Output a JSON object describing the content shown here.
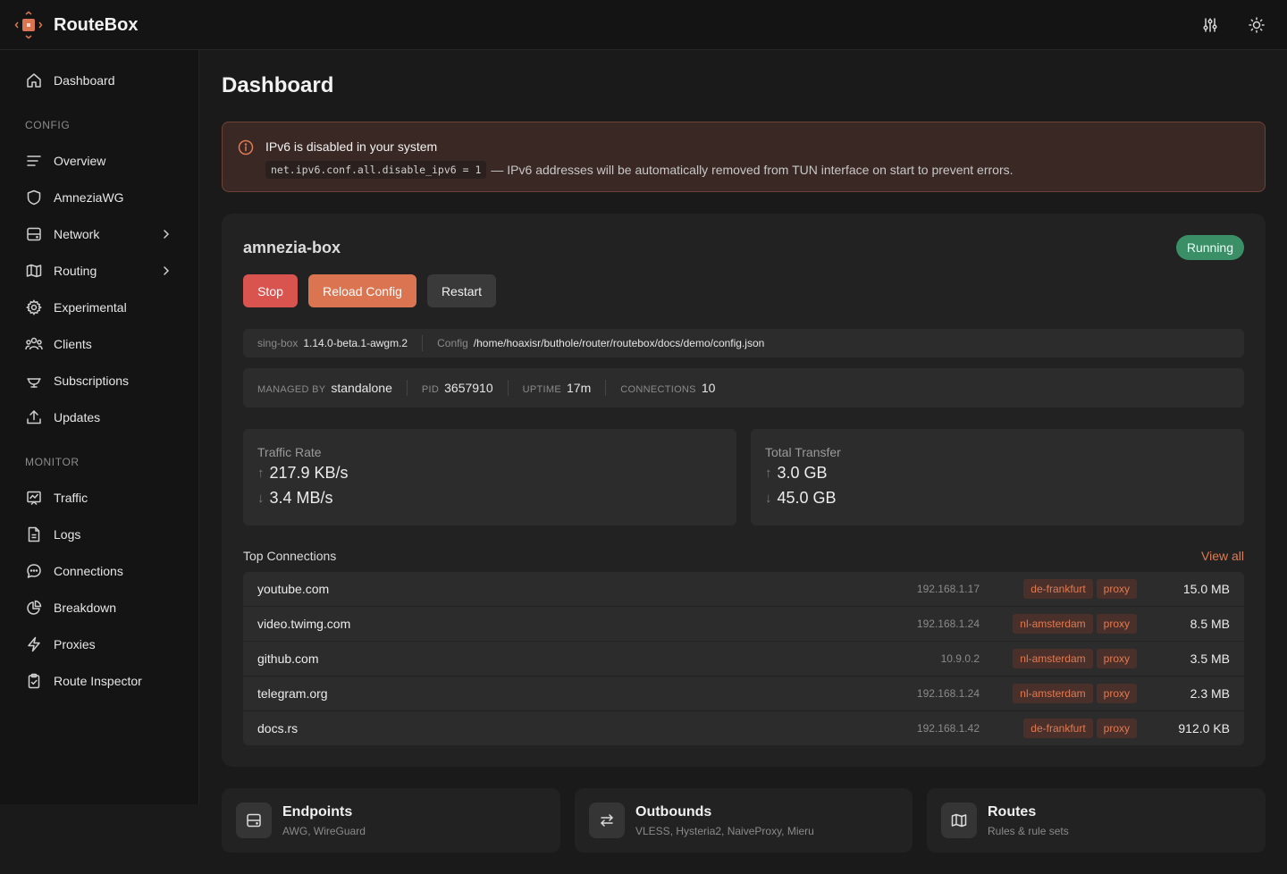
{
  "app": {
    "name": "RouteBox",
    "accent": "#db7450"
  },
  "header": {
    "icons": [
      "sliders-icon",
      "sun-icon"
    ]
  },
  "sidebar": {
    "sections": {
      "config": "CONFIG",
      "monitor": "MONITOR"
    },
    "items": [
      {
        "label": "Dashboard",
        "icon": "home-icon"
      },
      {
        "label": "Overview",
        "icon": "list-icon"
      },
      {
        "label": "AmneziaWG",
        "icon": "shield-icon"
      },
      {
        "label": "Network",
        "icon": "server-icon"
      },
      {
        "label": "Routing",
        "icon": "map-icon"
      },
      {
        "label": "Experimental",
        "icon": "gear-icon"
      },
      {
        "label": "Clients",
        "icon": "users-icon"
      },
      {
        "label": "Subscriptions",
        "icon": "bowl-icon"
      },
      {
        "label": "Updates",
        "icon": "upload-icon"
      },
      {
        "label": "Traffic",
        "icon": "chart-icon"
      },
      {
        "label": "Logs",
        "icon": "file-icon"
      },
      {
        "label": "Connections",
        "icon": "chat-icon"
      },
      {
        "label": "Breakdown",
        "icon": "pie-icon"
      },
      {
        "label": "Proxies",
        "icon": "bolt-icon"
      },
      {
        "label": "Route Inspector",
        "icon": "clipboard-check-icon"
      }
    ]
  },
  "page": {
    "title": "Dashboard"
  },
  "alert": {
    "title": "IPv6 is disabled in your system",
    "code": "net.ipv6.conf.all.disable_ipv6 = 1",
    "message": "— IPv6 addresses will be automatically removed from TUN interface on start to prevent errors."
  },
  "service": {
    "name": "amnezia-box",
    "status": "Running",
    "status_color": "#3b8f67",
    "buttons": {
      "stop": "Stop",
      "reload": "Reload Config",
      "restart": "Restart"
    },
    "info": {
      "singbox_label": "sing-box",
      "singbox_version": "1.14.0-beta.1-awgm.2",
      "config_label": "Config",
      "config_path": "/home/hoaxisr/buthole/router/routebox/docs/demo/config.json",
      "managed_label": "MANAGED BY",
      "managed_value": "standalone",
      "pid_label": "PID",
      "pid_value": "3657910",
      "uptime_label": "UPTIME",
      "uptime_value": "17m",
      "connections_label": "CONNECTIONS",
      "connections_value": "10"
    },
    "traffic_rate": {
      "title": "Traffic Rate",
      "up": "217.9 KB/s",
      "down": "3.4 MB/s"
    },
    "total_transfer": {
      "title": "Total Transfer",
      "up": "3.0 GB",
      "down": "45.0 GB"
    },
    "arrows": {
      "up": "↑",
      "down": "↓"
    }
  },
  "top_connections": {
    "title": "Top Connections",
    "view_all": "View all",
    "rows": [
      {
        "host": "youtube.com",
        "ip": "192.168.1.17",
        "outbound": "de-frankfurt",
        "rule": "proxy",
        "size": "15.0 MB"
      },
      {
        "host": "video.twimg.com",
        "ip": "192.168.1.24",
        "outbound": "nl-amsterdam",
        "rule": "proxy",
        "size": "8.5 MB"
      },
      {
        "host": "github.com",
        "ip": "10.9.0.2",
        "outbound": "nl-amsterdam",
        "rule": "proxy",
        "size": "3.5 MB"
      },
      {
        "host": "telegram.org",
        "ip": "192.168.1.24",
        "outbound": "nl-amsterdam",
        "rule": "proxy",
        "size": "2.3 MB"
      },
      {
        "host": "docs.rs",
        "ip": "192.168.1.42",
        "outbound": "de-frankfurt",
        "rule": "proxy",
        "size": "912.0 KB"
      }
    ]
  },
  "quick_links": [
    {
      "title": "Endpoints",
      "subtitle": "AWG, WireGuard",
      "icon": "server-icon"
    },
    {
      "title": "Outbounds",
      "subtitle": "VLESS, Hysteria2, NaiveProxy, Mieru",
      "icon": "swap-icon"
    },
    {
      "title": "Routes",
      "subtitle": "Rules & rule sets",
      "icon": "map-icon"
    }
  ]
}
